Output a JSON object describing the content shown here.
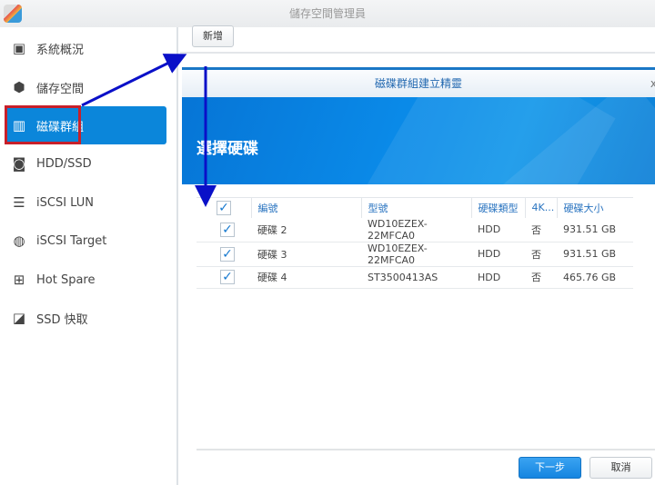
{
  "window": {
    "title": "儲存空間管理員"
  },
  "sidebar": {
    "items": [
      {
        "label": "系統概況",
        "icon": "overview-icon"
      },
      {
        "label": "儲存空間",
        "icon": "storage-cubes-icon"
      },
      {
        "label": "磁碟群組",
        "icon": "disk-group-icon",
        "selected": true
      },
      {
        "label": "HDD/SSD",
        "icon": "hdd-icon"
      },
      {
        "label": "iSCSI LUN",
        "icon": "database-icon"
      },
      {
        "label": "iSCSI Target",
        "icon": "globe-icon"
      },
      {
        "label": "Hot Spare",
        "icon": "plus-box-icon"
      },
      {
        "label": "SSD 快取",
        "icon": "ssd-cache-icon"
      }
    ]
  },
  "toolbar": {
    "add_label": "新增"
  },
  "dialog": {
    "title": "磁碟群組建立精靈",
    "close": "x",
    "step_title": "選擇硬碟",
    "columns": [
      "編號",
      "型號",
      "硬碟類型",
      "4K...",
      "硬碟大小"
    ],
    "rows": [
      {
        "checked": true,
        "id": "硬碟 2",
        "model": "WD10EZEX-22MFCA0",
        "type": "HDD",
        "4k": "否",
        "size": "931.51 GB"
      },
      {
        "checked": true,
        "id": "硬碟 3",
        "model": "WD10EZEX-22MFCA0",
        "type": "HDD",
        "4k": "否",
        "size": "931.51 GB"
      },
      {
        "checked": true,
        "id": "硬碟 4",
        "model": "ST3500413AS",
        "type": "HDD",
        "4k": "否",
        "size": "465.76 GB"
      }
    ],
    "next_label": "下一步",
    "cancel_label": "取消"
  },
  "colors": {
    "accent": "#0b86da",
    "highlight": "#c8202a",
    "annotation": "#0a10c8"
  }
}
